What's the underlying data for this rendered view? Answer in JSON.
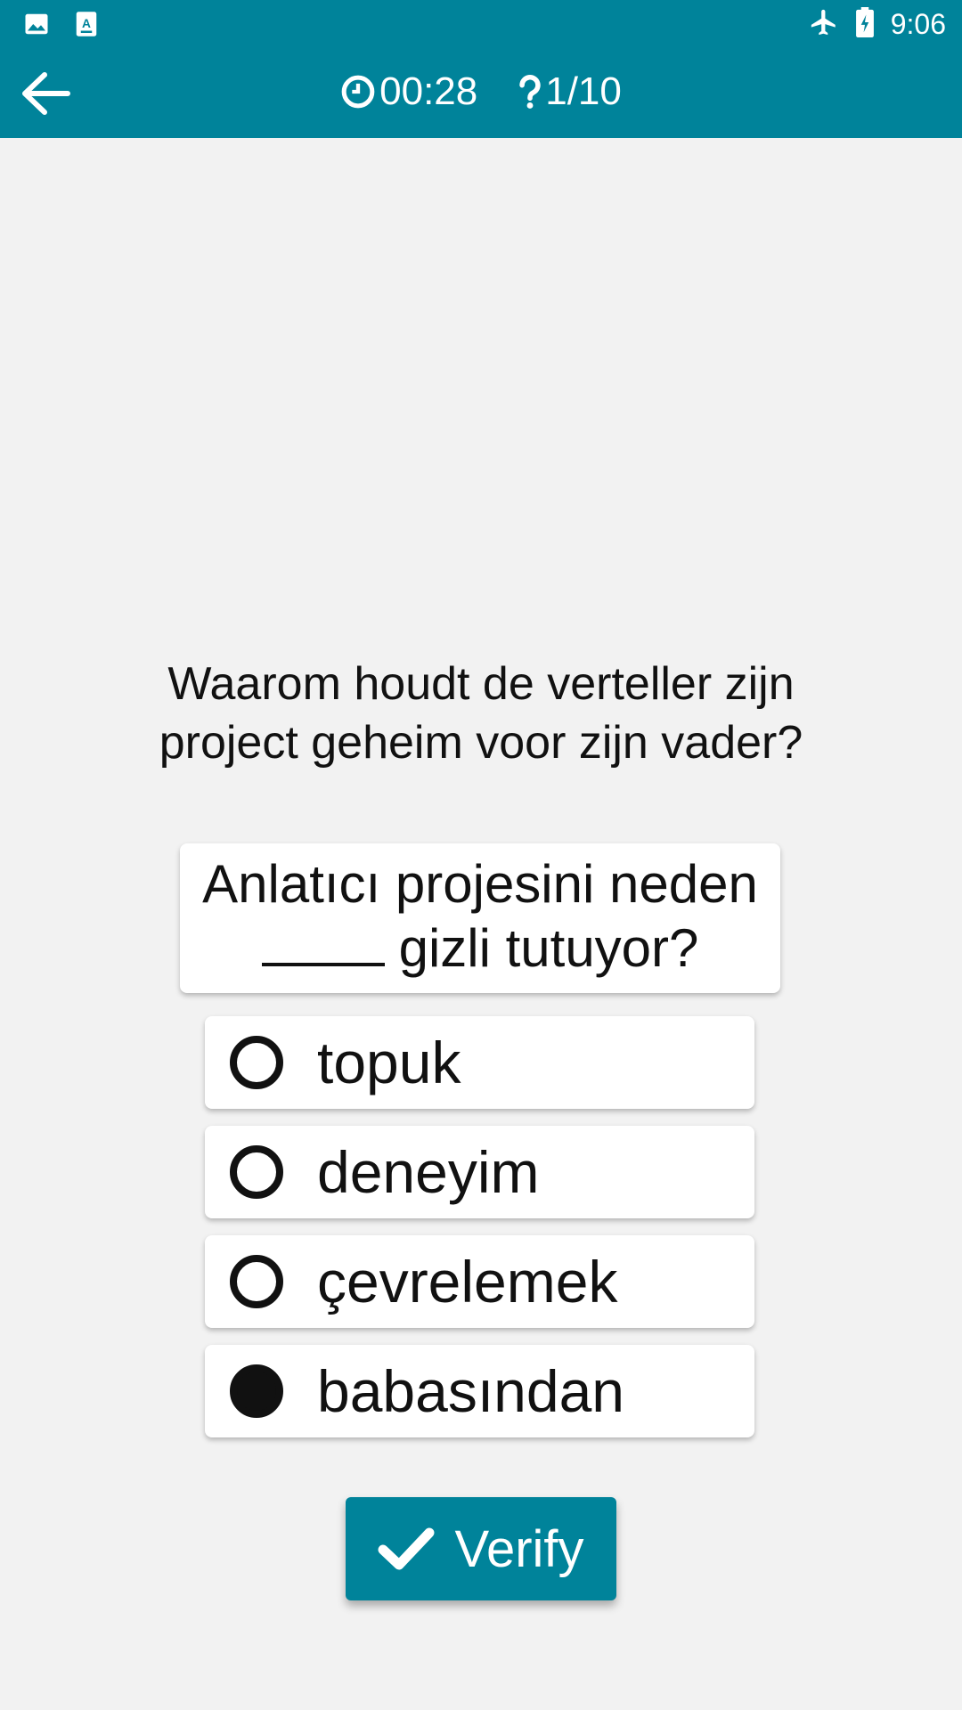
{
  "status_bar": {
    "time": "9:06"
  },
  "app_bar": {
    "timer": "00:28",
    "progress": "1/10"
  },
  "question": "Waarom houdt de verteller zijn project geheim voor zijn vader?",
  "prompt": {
    "before": "Anlatıcı projesini neden",
    "after": "gizli tutuyor?"
  },
  "options": [
    {
      "label": "topuk",
      "selected": false
    },
    {
      "label": "deneyim",
      "selected": false
    },
    {
      "label": "çevrelemek",
      "selected": false
    },
    {
      "label": "babasından",
      "selected": true
    }
  ],
  "verify_label": "Verify",
  "colors": {
    "accent": "#00839a",
    "background": "#f2f2f2"
  }
}
